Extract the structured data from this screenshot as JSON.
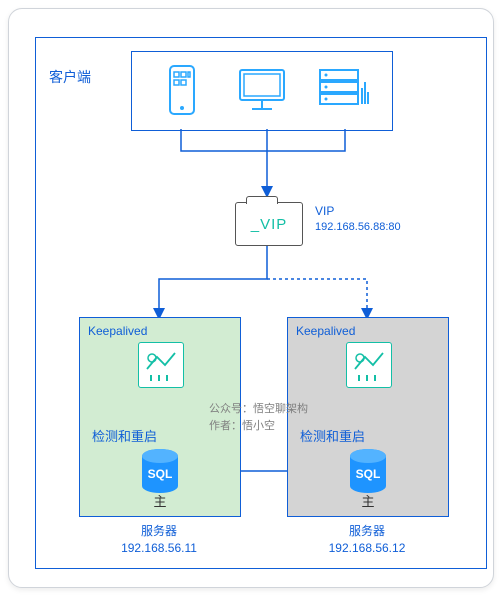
{
  "labels": {
    "client": "客户端",
    "vip": "VIP",
    "vip_text": "_VIP",
    "vip_addr": "192.168.56.88:80",
    "keepalived": "Keepalived",
    "check_restart": "检测和重启",
    "master": "主",
    "server": "服务器",
    "sql": "SQL"
  },
  "servers": {
    "primary_ip": "192.168.56.11",
    "standby_ip": "192.168.56.12"
  },
  "credit": {
    "line1": "公众号：悟空聊架构",
    "line2": "作者：悟小空"
  },
  "colors": {
    "blue": "#0f5ed7",
    "teal": "#13bfa6",
    "icon_blue": "#2aa8ff"
  }
}
